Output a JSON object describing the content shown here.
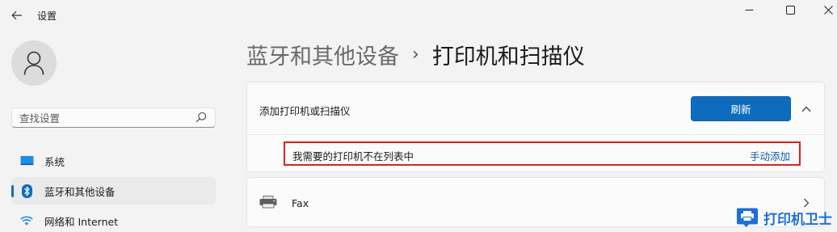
{
  "titlebar": {
    "app_title": "设置",
    "back_icon": "arrow-left-icon",
    "window_controls": [
      "minimize-icon",
      "maximize-icon",
      "close-icon"
    ]
  },
  "sidebar": {
    "search": {
      "placeholder": "查找设置",
      "icon": "search-icon"
    },
    "items": [
      {
        "label": "系统",
        "icon": "monitor-icon",
        "selected": false
      },
      {
        "label": "蓝牙和其他设备",
        "icon": "bluetooth-icon",
        "selected": true
      },
      {
        "label": "网络和 Internet",
        "icon": "wifi-icon",
        "selected": false
      }
    ]
  },
  "breadcrumb": {
    "parent": "蓝牙和其他设备",
    "separator": "›",
    "current": "打印机和扫描仪"
  },
  "add_printer": {
    "label": "添加打印机或扫描仪",
    "refresh_label": "刷新",
    "missing_text": "我需要的打印机不在列表中",
    "manual_add_label": "手动添加"
  },
  "devices": [
    {
      "name": "Fax",
      "icon": "fax-printer-icon"
    }
  ],
  "watermark": {
    "text": "打印机卫士"
  },
  "colors": {
    "accent": "#0f6cbd",
    "highlight_border": "#e0201b",
    "link": "#0f5aa8",
    "watermark": "#1d6fd8"
  }
}
